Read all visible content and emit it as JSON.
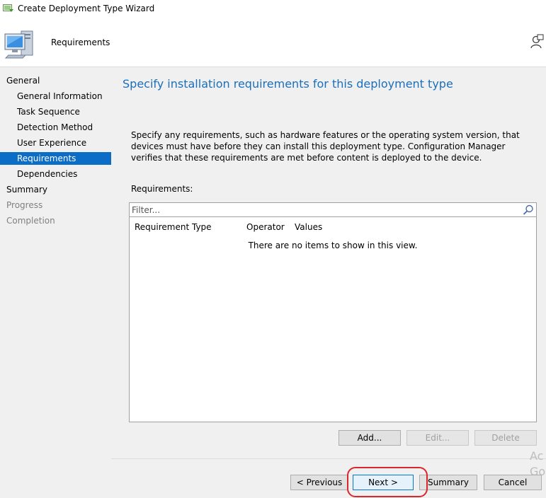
{
  "window": {
    "title": "Create Deployment Type Wizard"
  },
  "header": {
    "title": "Requirements",
    "icon": "computer-icon",
    "help_icon": "user-help-icon"
  },
  "nav": {
    "items": [
      {
        "label": "General",
        "state": "normal"
      },
      {
        "label": "General Information",
        "state": "normal"
      },
      {
        "label": "Task Sequence",
        "state": "normal"
      },
      {
        "label": "Detection Method",
        "state": "normal"
      },
      {
        "label": "User Experience",
        "state": "normal"
      },
      {
        "label": "Requirements",
        "state": "active"
      },
      {
        "label": "Dependencies",
        "state": "normal"
      },
      {
        "label": "Summary",
        "state": "normal"
      },
      {
        "label": "Progress",
        "state": "disabled"
      },
      {
        "label": "Completion",
        "state": "disabled"
      }
    ]
  },
  "main": {
    "title": "Specify installation requirements for this deployment type",
    "description": "Specify any requirements, such as hardware features or the operating system version, that devices must have before they can install this deployment type. Configuration Manager verifies that these requirements are met before content is deployed to the device.",
    "requirements_label": "Requirements:",
    "filter": {
      "placeholder": "Filter...",
      "value": ""
    },
    "columns": [
      "Requirement Type",
      "Operator",
      "Values"
    ],
    "empty_message": "There are no items to show in this view.",
    "list_buttons": {
      "add": "Add...",
      "edit": "Edit...",
      "delete": "Delete"
    }
  },
  "footer": {
    "previous": "< Previous",
    "next": "Next >",
    "summary": "Summary",
    "cancel": "Cancel"
  },
  "watermark": {
    "line1": "Ac",
    "line2": "Go"
  },
  "colors": {
    "accent": "#0c6dc7",
    "title": "#1a6fba",
    "highlight": "#d9272e",
    "panel": "#f0f0f0"
  }
}
